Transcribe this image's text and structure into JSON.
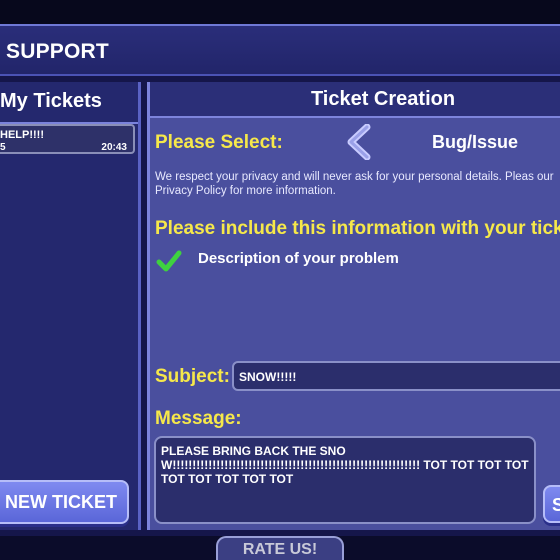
{
  "header": {
    "title": "SUPPORT"
  },
  "my_tickets": {
    "title": "My Tickets",
    "items": [
      {
        "subject": "HELP!!!!",
        "status": "5",
        "time": "20:43"
      }
    ],
    "create_button": "TE NEW TICKET"
  },
  "ticket_creation": {
    "title": "Ticket Creation",
    "select_label": "Please Select:",
    "select_value": "Bug/Issue",
    "privacy_text": "We respect your privacy and will never ask for your personal details. Pleas our Privacy Policy for more information.",
    "include_label": "Please include this information with your ticket:",
    "checklist": [
      "Description of your problem"
    ],
    "subject_label": "Subject:",
    "subject_value": "SNOW!!!!!",
    "message_label": "Message:",
    "message_value": "PLEASE BRING BACK THE SNOW!!!!!!!!!!!!!!!!!!!!!!!!!!!!!!!!!!!!!!!!!!!!!!!!!!!!!!!!!!!!!! TOT TOT TOT TOT TOT TOT TOT TOT TOT",
    "send_button": "S"
  },
  "footer": {
    "rate_label": "RATE US!"
  },
  "colors": {
    "accent_yellow": "#f6e84a",
    "panel": "#4a4f9e",
    "check_green": "#3fd13f"
  }
}
